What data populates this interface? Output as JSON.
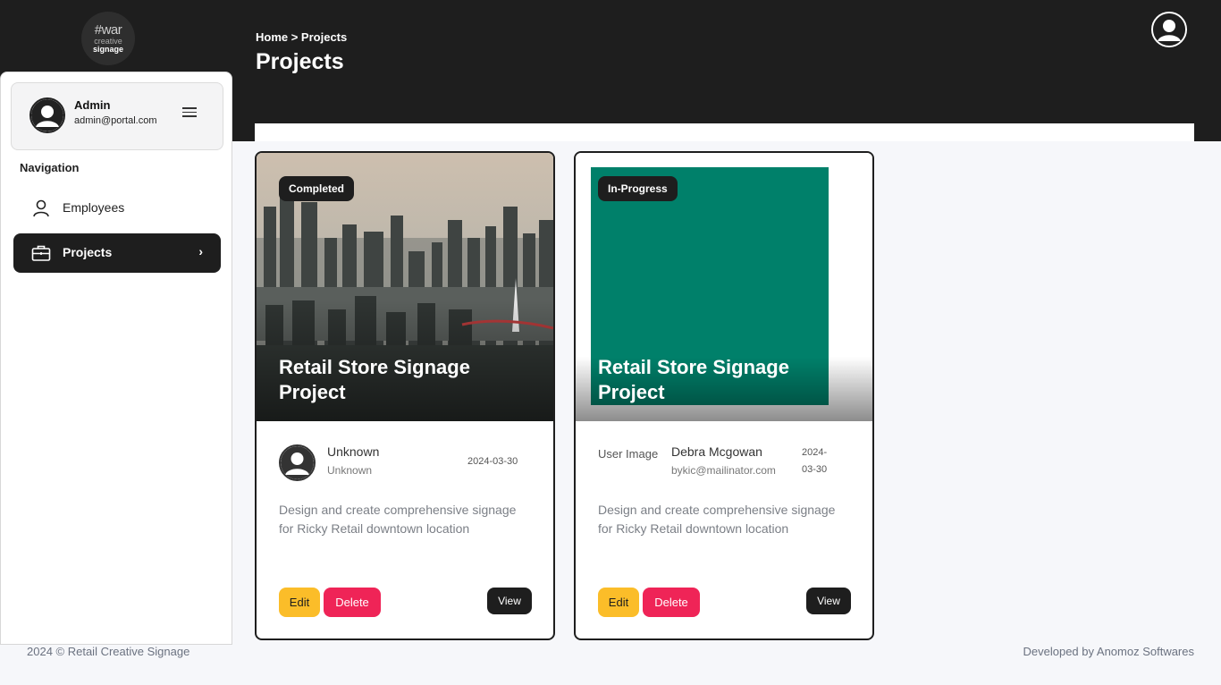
{
  "logo": {
    "line1": "#war",
    "line2": "creative",
    "line3": "signage"
  },
  "header": {
    "breadcrumb": "Home > Projects",
    "title": "Projects"
  },
  "user": {
    "name": "Admin",
    "email": "admin@portal.com"
  },
  "nav": {
    "heading": "Navigation",
    "items": [
      {
        "label": "Employees",
        "icon": "user-icon",
        "active": false
      },
      {
        "label": "Projects",
        "icon": "briefcase-icon",
        "active": true
      }
    ]
  },
  "cards": [
    {
      "status": "Completed",
      "title": "Retail Store Signage Project",
      "owner_name": "Unknown",
      "owner_sub": "Unknown",
      "date": "2024-03-30",
      "description": "Design and create comprehensive signage for Ricky Retail downtown location",
      "edit": "Edit",
      "delete": "Delete",
      "view": "View"
    },
    {
      "status": "In-Progress",
      "title": "Retail Store Signage Project",
      "image_alt": "User Image",
      "owner_name": "Debra Mcgowan",
      "owner_sub": "bykic@mailinator.com",
      "date_line1": "2024-",
      "date_line2": "03-30",
      "description": "Design and create comprehensive signage for Ricky Retail downtown location",
      "edit": "Edit",
      "delete": "Delete",
      "view": "View"
    }
  ],
  "footer": {
    "left": "2024  © Retail Creative Signage",
    "right": "Developed by Anomoz Softwares"
  },
  "colors": {
    "dark": "#1e1e1e",
    "edit": "#fbbd29",
    "delete": "#ef2457",
    "teal": "#00806a"
  }
}
